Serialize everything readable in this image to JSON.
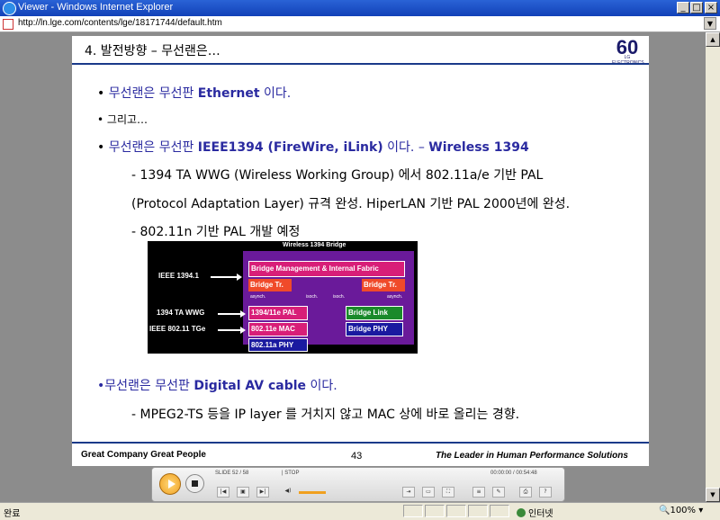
{
  "window": {
    "title": "Viewer - Windows Internet Explorer",
    "url": "http://ln.lge.com/contents/lge/18171744/default.htm"
  },
  "slide": {
    "title": "4. 발전방향 – 무선랜은…",
    "logo_text": "60",
    "logo_sub": "LG ELECTRONICS",
    "bullets": [
      {
        "kor": "무선랜은 무선판 ",
        "bold": "Ethernet",
        "tail": " 이다."
      },
      {
        "kor": "그리고…"
      },
      {
        "kor": "무선랜은 무선판 ",
        "bold": "IEEE1394 (FireWire, iLink)",
        "tail": " 이다. – ",
        "bold2": "Wireless 1394"
      }
    ],
    "sub1": "- 1394 TA WWG (Wireless Working Group) 에서 802.11a/e 기반 PAL",
    "sub2": "(Protocol Adaptation Layer) 규격 완성. HiperLAN 기반 PAL 2000년에 완성.",
    "sub3": "-  802.11n 기반 PAL 개발 예정",
    "bullet4": {
      "kor": "무선랜은 무선판 ",
      "bold": "Digital AV cable",
      "tail": " 이다."
    },
    "sub4": "-  MPEG2-TS 등을 IP layer 를 거치지 않고 MAC 상에 바로 올리는 경향.",
    "footer_left": "Great Company   Great People",
    "page_number": "43",
    "footer_right": "The Leader in Human Performance Solutions"
  },
  "diagram": {
    "title": "Wireless 1394 Bridge",
    "ieee1394": "IEEE 1394.1",
    "mgmt": "Bridge Management & Internal Fabric",
    "bridge_tr": "Bridge Tr.",
    "asynch": "asynch.",
    "isoch": "isoch.",
    "ta_wwg": "1394 TA WWG",
    "tge": "IEEE 802.11 TGe",
    "pal": "1394/11e PAL",
    "mac": "802.11e MAC",
    "phy": "802.11a PHY",
    "bridge_link": "Bridge Link",
    "bridge_phy": "Bridge PHY"
  },
  "player": {
    "slide_label": "SLIDE 52 / 58",
    "state": "| STOP",
    "time": "00:00:00 / 00:54:48"
  },
  "status": {
    "left": "완료",
    "zone": "인터넷",
    "zoom": "100%"
  }
}
